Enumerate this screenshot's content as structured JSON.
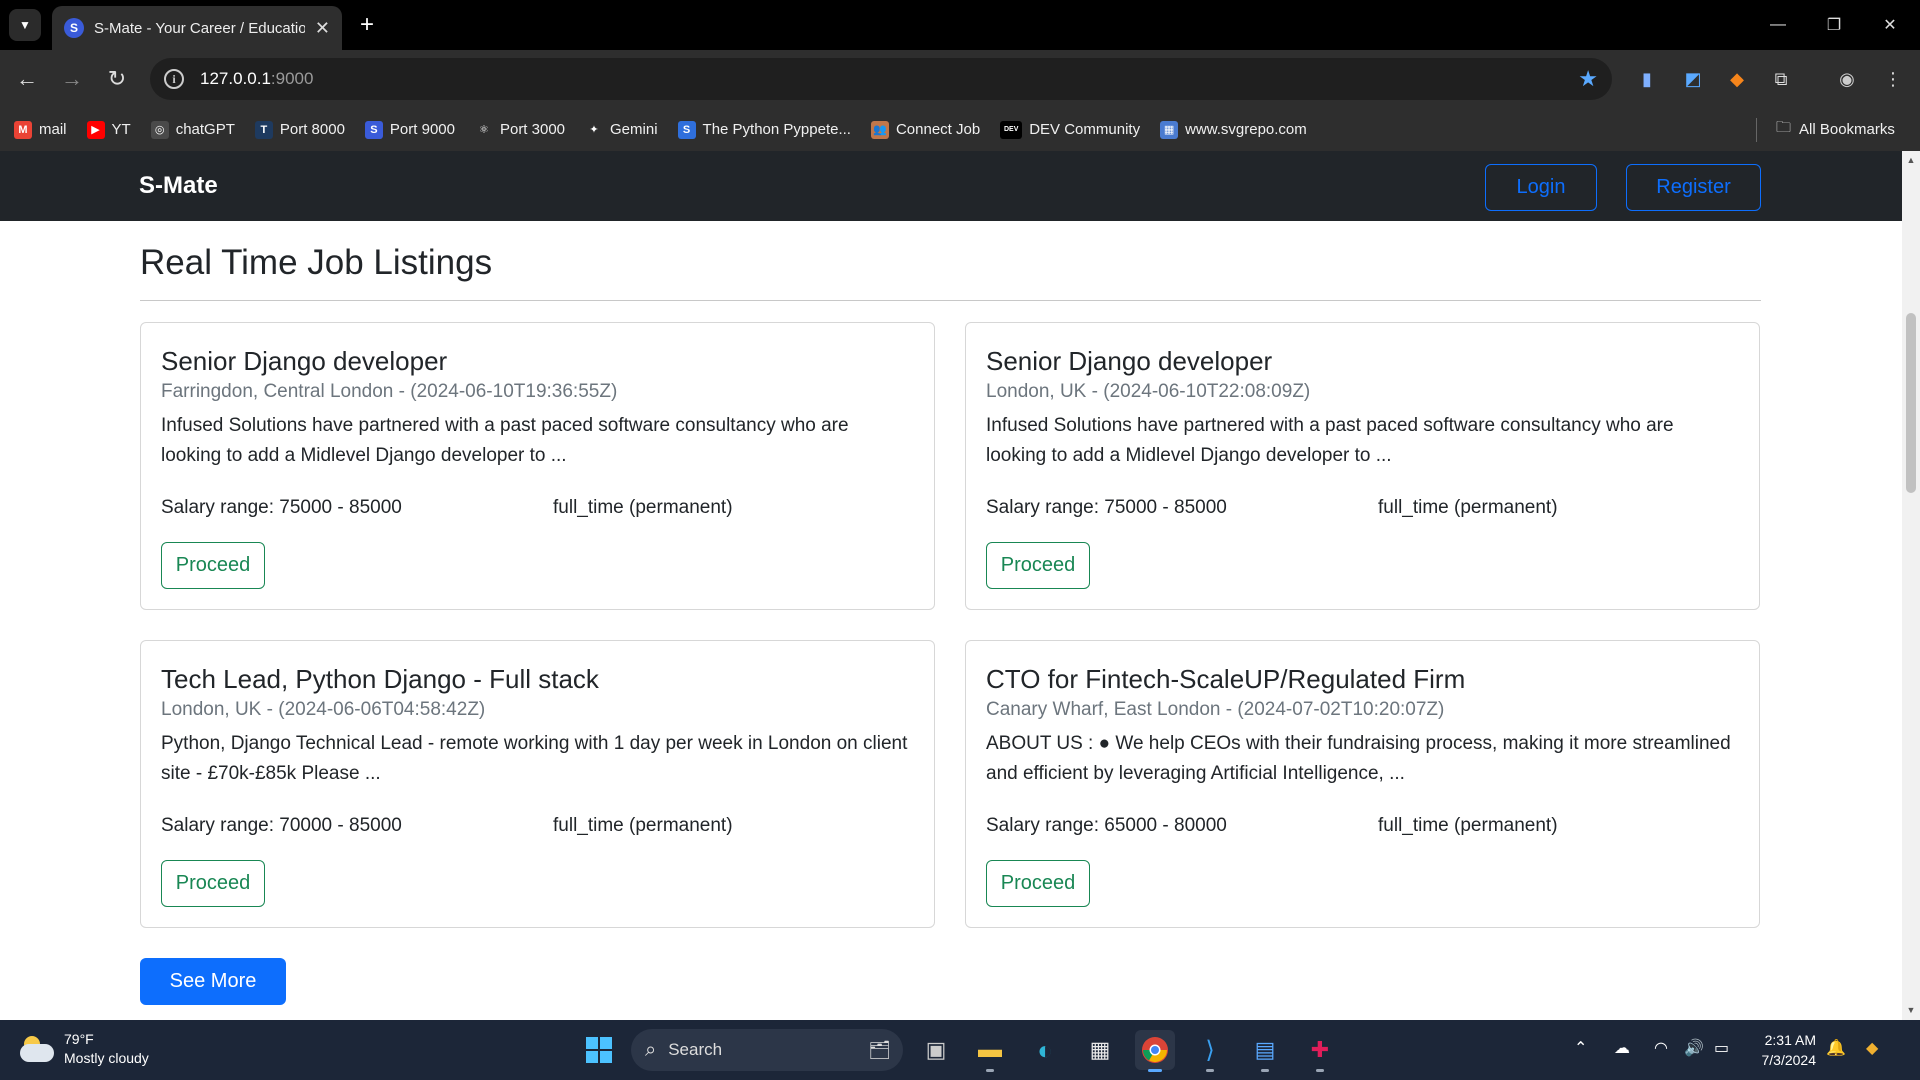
{
  "browser": {
    "tab_title": "S-Mate - Your Career / Educatio",
    "tab_favicon_letter": "S",
    "url_host": "127.0.0.1",
    "url_port": ":9000",
    "bookmarks": [
      {
        "label": "mail",
        "icon": "gmail-icon",
        "color": "#ea4335",
        "glyph": "M"
      },
      {
        "label": "YT",
        "icon": "youtube-icon",
        "color": "#ff0000",
        "glyph": "▶"
      },
      {
        "label": "chatGPT",
        "icon": "chatgpt-icon",
        "color": "#4a4a4a",
        "glyph": "◎"
      },
      {
        "label": "Port 8000",
        "icon": "port-8000-icon",
        "color": "#1e3a5f",
        "glyph": "T"
      },
      {
        "label": "Port 9000",
        "icon": "port-9000-icon",
        "color": "#3a5bd9",
        "glyph": "S"
      },
      {
        "label": "Port 3000",
        "icon": "react-icon",
        "color": "#2e2e2e",
        "glyph": "⚛"
      },
      {
        "label": "Gemini",
        "icon": "gemini-icon",
        "color": "#2e2e2e",
        "glyph": "✦"
      },
      {
        "label": "The Python Pyppete...",
        "icon": "python-pyppeteer-icon",
        "color": "#2f6fdc",
        "glyph": "S"
      },
      {
        "label": "Connect Job",
        "icon": "connect-job-icon",
        "color": "#c0774a",
        "glyph": "👥"
      },
      {
        "label": "DEV Community",
        "icon": "dev-community-icon",
        "color": "#000000",
        "glyph": "DEV"
      },
      {
        "label": "www.svgrepo.com",
        "icon": "svgrepo-icon",
        "color": "#4a7bd0",
        "glyph": "▦"
      }
    ],
    "all_bookmarks_label": "All Bookmarks"
  },
  "site": {
    "brand": "S-Mate",
    "login_label": "Login",
    "register_label": "Register",
    "page_title": "Real Time Job Listings",
    "see_more_label": "See More",
    "jobs": [
      {
        "title": "Senior Django developer",
        "location_date": "Farringdon, Central London - (2024-06-10T19:36:55Z)",
        "description": "Infused Solutions have partnered with a past paced software consultancy who are looking to add a Midlevel Django developer to ...",
        "salary": "Salary range: 75000 - 85000",
        "type": "full_time (permanent)",
        "action": "Proceed"
      },
      {
        "title": "Senior Django developer",
        "location_date": "London, UK - (2024-06-10T22:08:09Z)",
        "description": "Infused Solutions have partnered with a past paced software consultancy who are looking to add a Midlevel Django developer to ...",
        "salary": "Salary range: 75000 - 85000",
        "type": "full_time (permanent)",
        "action": "Proceed"
      },
      {
        "title": "Tech Lead, Python Django - Full stack",
        "location_date": "London, UK - (2024-06-06T04:58:42Z)",
        "description": "Python, Django Technical Lead - remote working with 1 day per week in London on client site - £70k-£85k Please ...",
        "salary": "Salary range: 70000 - 85000",
        "type": "full_time (permanent)",
        "action": "Proceed"
      },
      {
        "title": "CTO for Fintech-ScaleUP/Regulated Firm",
        "location_date": "Canary Wharf, East London - (2024-07-02T10:20:07Z)",
        "description": "ABOUT US : ● We help CEOs with their fundraising process, making it more streamlined and efficient by leveraging Artificial Intelligence, ...",
        "salary": "Salary range: 65000 - 80000",
        "type": "full_time (permanent)",
        "action": "Proceed"
      }
    ]
  },
  "taskbar": {
    "weather_temp": "79°F",
    "weather_desc": "Mostly cloudy",
    "search_label": "Search",
    "time": "2:31 AM",
    "date": "7/3/2024"
  },
  "colors": {
    "primary": "#0d6efd",
    "success": "#198754",
    "navbar": "#212529"
  }
}
